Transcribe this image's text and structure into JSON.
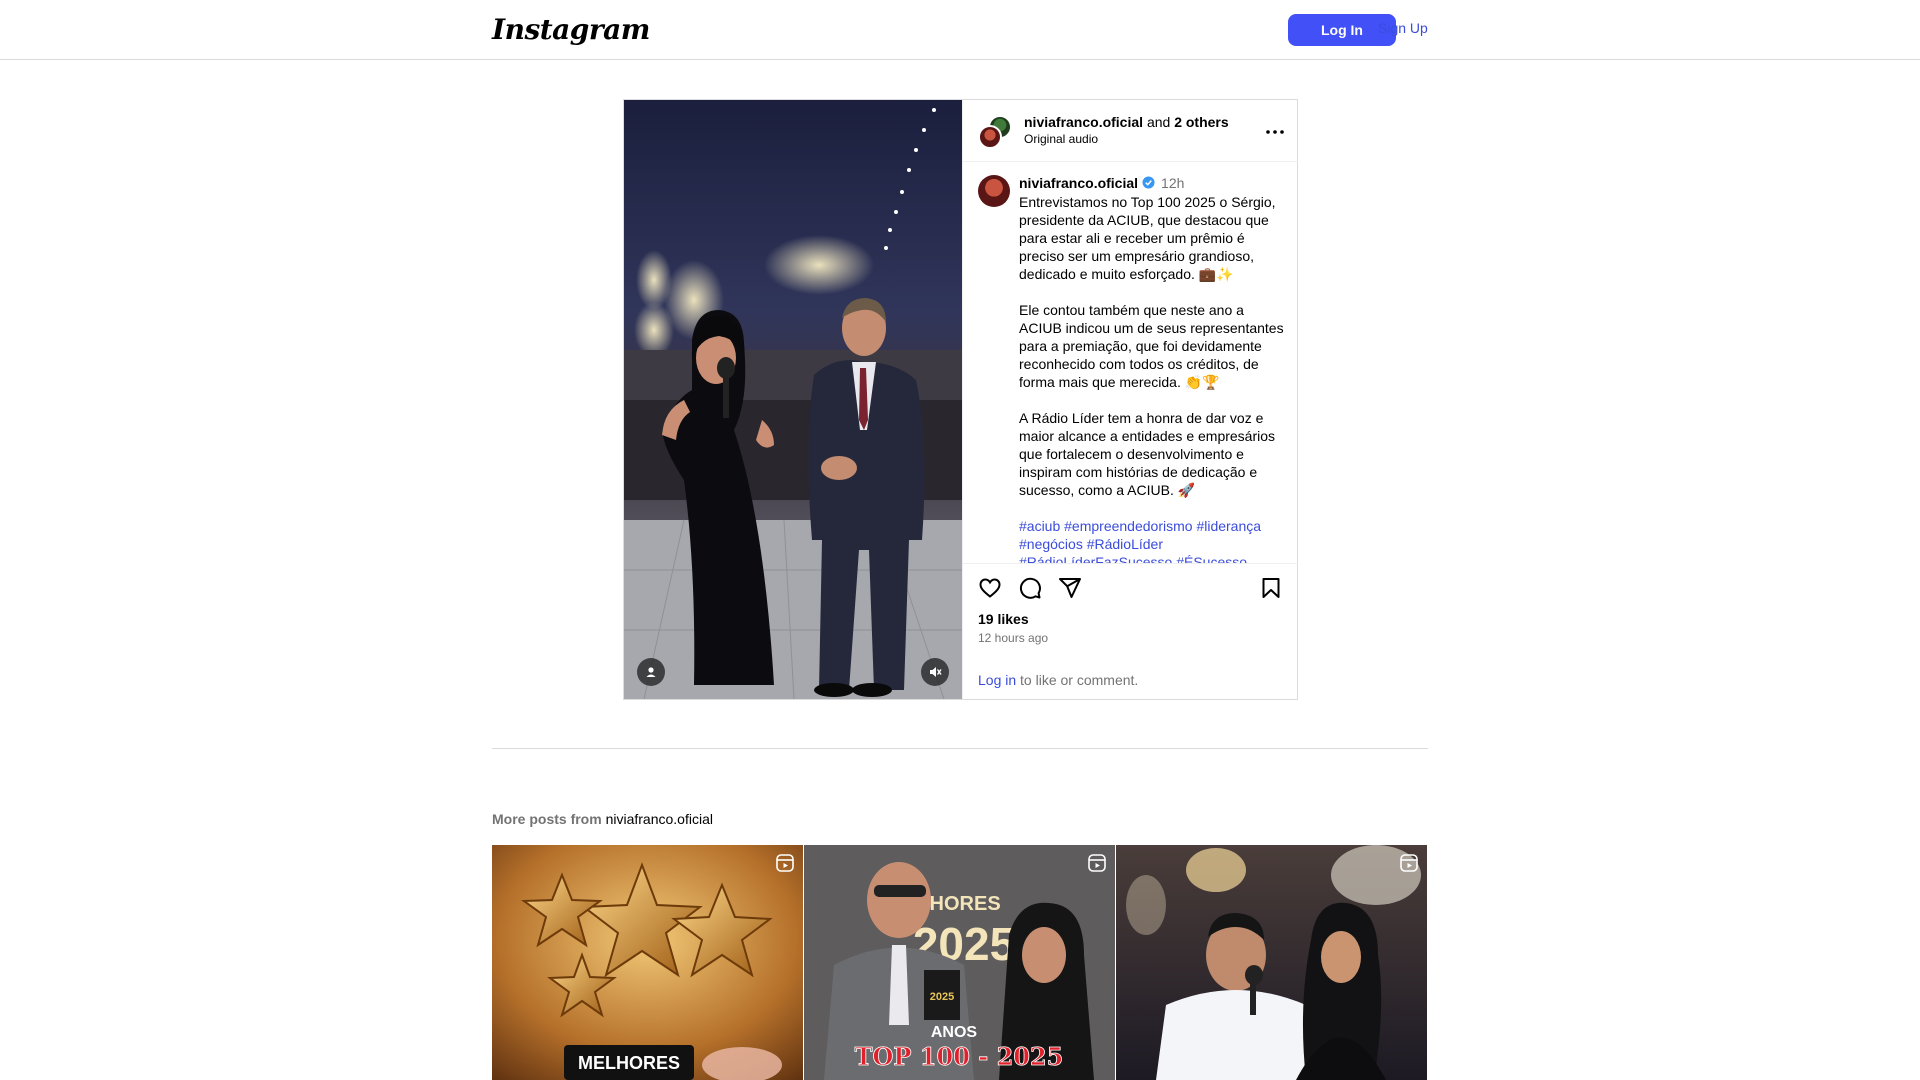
{
  "nav": {
    "logo": "Instagram",
    "login_label": "Log In",
    "signup_label": "Sign Up"
  },
  "post": {
    "header": {
      "username": "niviafranco.oficial",
      "joiner": "and",
      "others": "2 others",
      "audio": "Original audio"
    },
    "caption": {
      "username": "niviafranco.oficial",
      "time": "12h",
      "paragraph1": "Entrevistamos no Top 100 2025 o Sérgio, presidente da ACIUB, que destacou que para estar ali e receber um prêmio é preciso ser um empresário grandioso, dedicado e muito esforçado. 💼✨",
      "paragraph2": "Ele contou também que neste ano a ACIUB indicou um de seus representantes para a premiação, que foi devidamente reconhecido com todos os créditos, de forma mais que merecida. 👏🏆",
      "paragraph3": "A Rádio Líder tem a honra de dar voz e maior alcance a entidades e empresários que fortalecem o desenvolvimento e inspiram com histórias de dedicação e sucesso, como a ACIUB. 🚀",
      "hashtags": "#aciub #empreendedorismo #liderança #negócios #RádioLíder #RádioLíderFazSucesso #ÉSucesso"
    },
    "likes": "19 likes",
    "time_ago": "12 hours ago",
    "login_link": "Log in",
    "login_suffix": " to like or comment."
  },
  "more_posts": {
    "prefix": "More posts from ",
    "username": "niviafranco.oficial",
    "tiles": [
      {
        "overlay_text": "MELHORES",
        "icon": "reels-icon"
      },
      {
        "overlay_text": "MELHORES",
        "overlay_text2": "2025",
        "overlay_text3": "TOP 100 - 2025",
        "overlay_text4": "ANOS",
        "icon": "reels-icon"
      },
      {
        "icon": "reels-icon"
      }
    ]
  },
  "colors": {
    "accent": "#4150f7",
    "link": "#3b4cdb",
    "muted": "#737373",
    "border": "#dbdbdb"
  }
}
